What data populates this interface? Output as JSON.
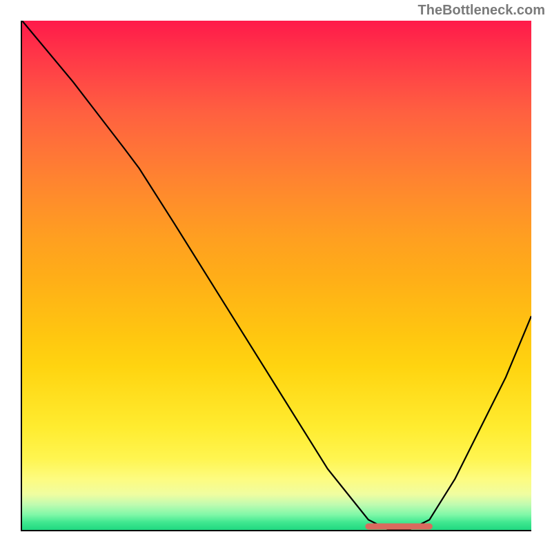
{
  "attribution": "TheBottleneck.com",
  "chart_data": {
    "type": "line",
    "title": "",
    "xlabel": "",
    "ylabel": "",
    "xlim": [
      0,
      100
    ],
    "ylim": [
      0,
      100
    ],
    "series": [
      {
        "name": "bottleneck-curve",
        "x": [
          0,
          10,
          20,
          23,
          30,
          40,
          50,
          60,
          68,
          72,
          76,
          80,
          85,
          90,
          95,
          100
        ],
        "y": [
          100,
          88,
          75,
          71,
          60,
          44,
          28,
          12,
          2,
          0,
          0,
          2,
          10,
          20,
          30,
          42
        ]
      }
    ],
    "highlight_range": {
      "name": "optimal-zone",
      "x_start": 68,
      "x_end": 80,
      "y": 0,
      "color": "#d96a5e"
    },
    "background": {
      "type": "vertical-gradient",
      "stops": [
        {
          "pos": 0.0,
          "color": "#ff1a4a"
        },
        {
          "pos": 0.5,
          "color": "#ffad18"
        },
        {
          "pos": 0.86,
          "color": "#fff550"
        },
        {
          "pos": 1.0,
          "color": "#20d880"
        }
      ]
    }
  }
}
